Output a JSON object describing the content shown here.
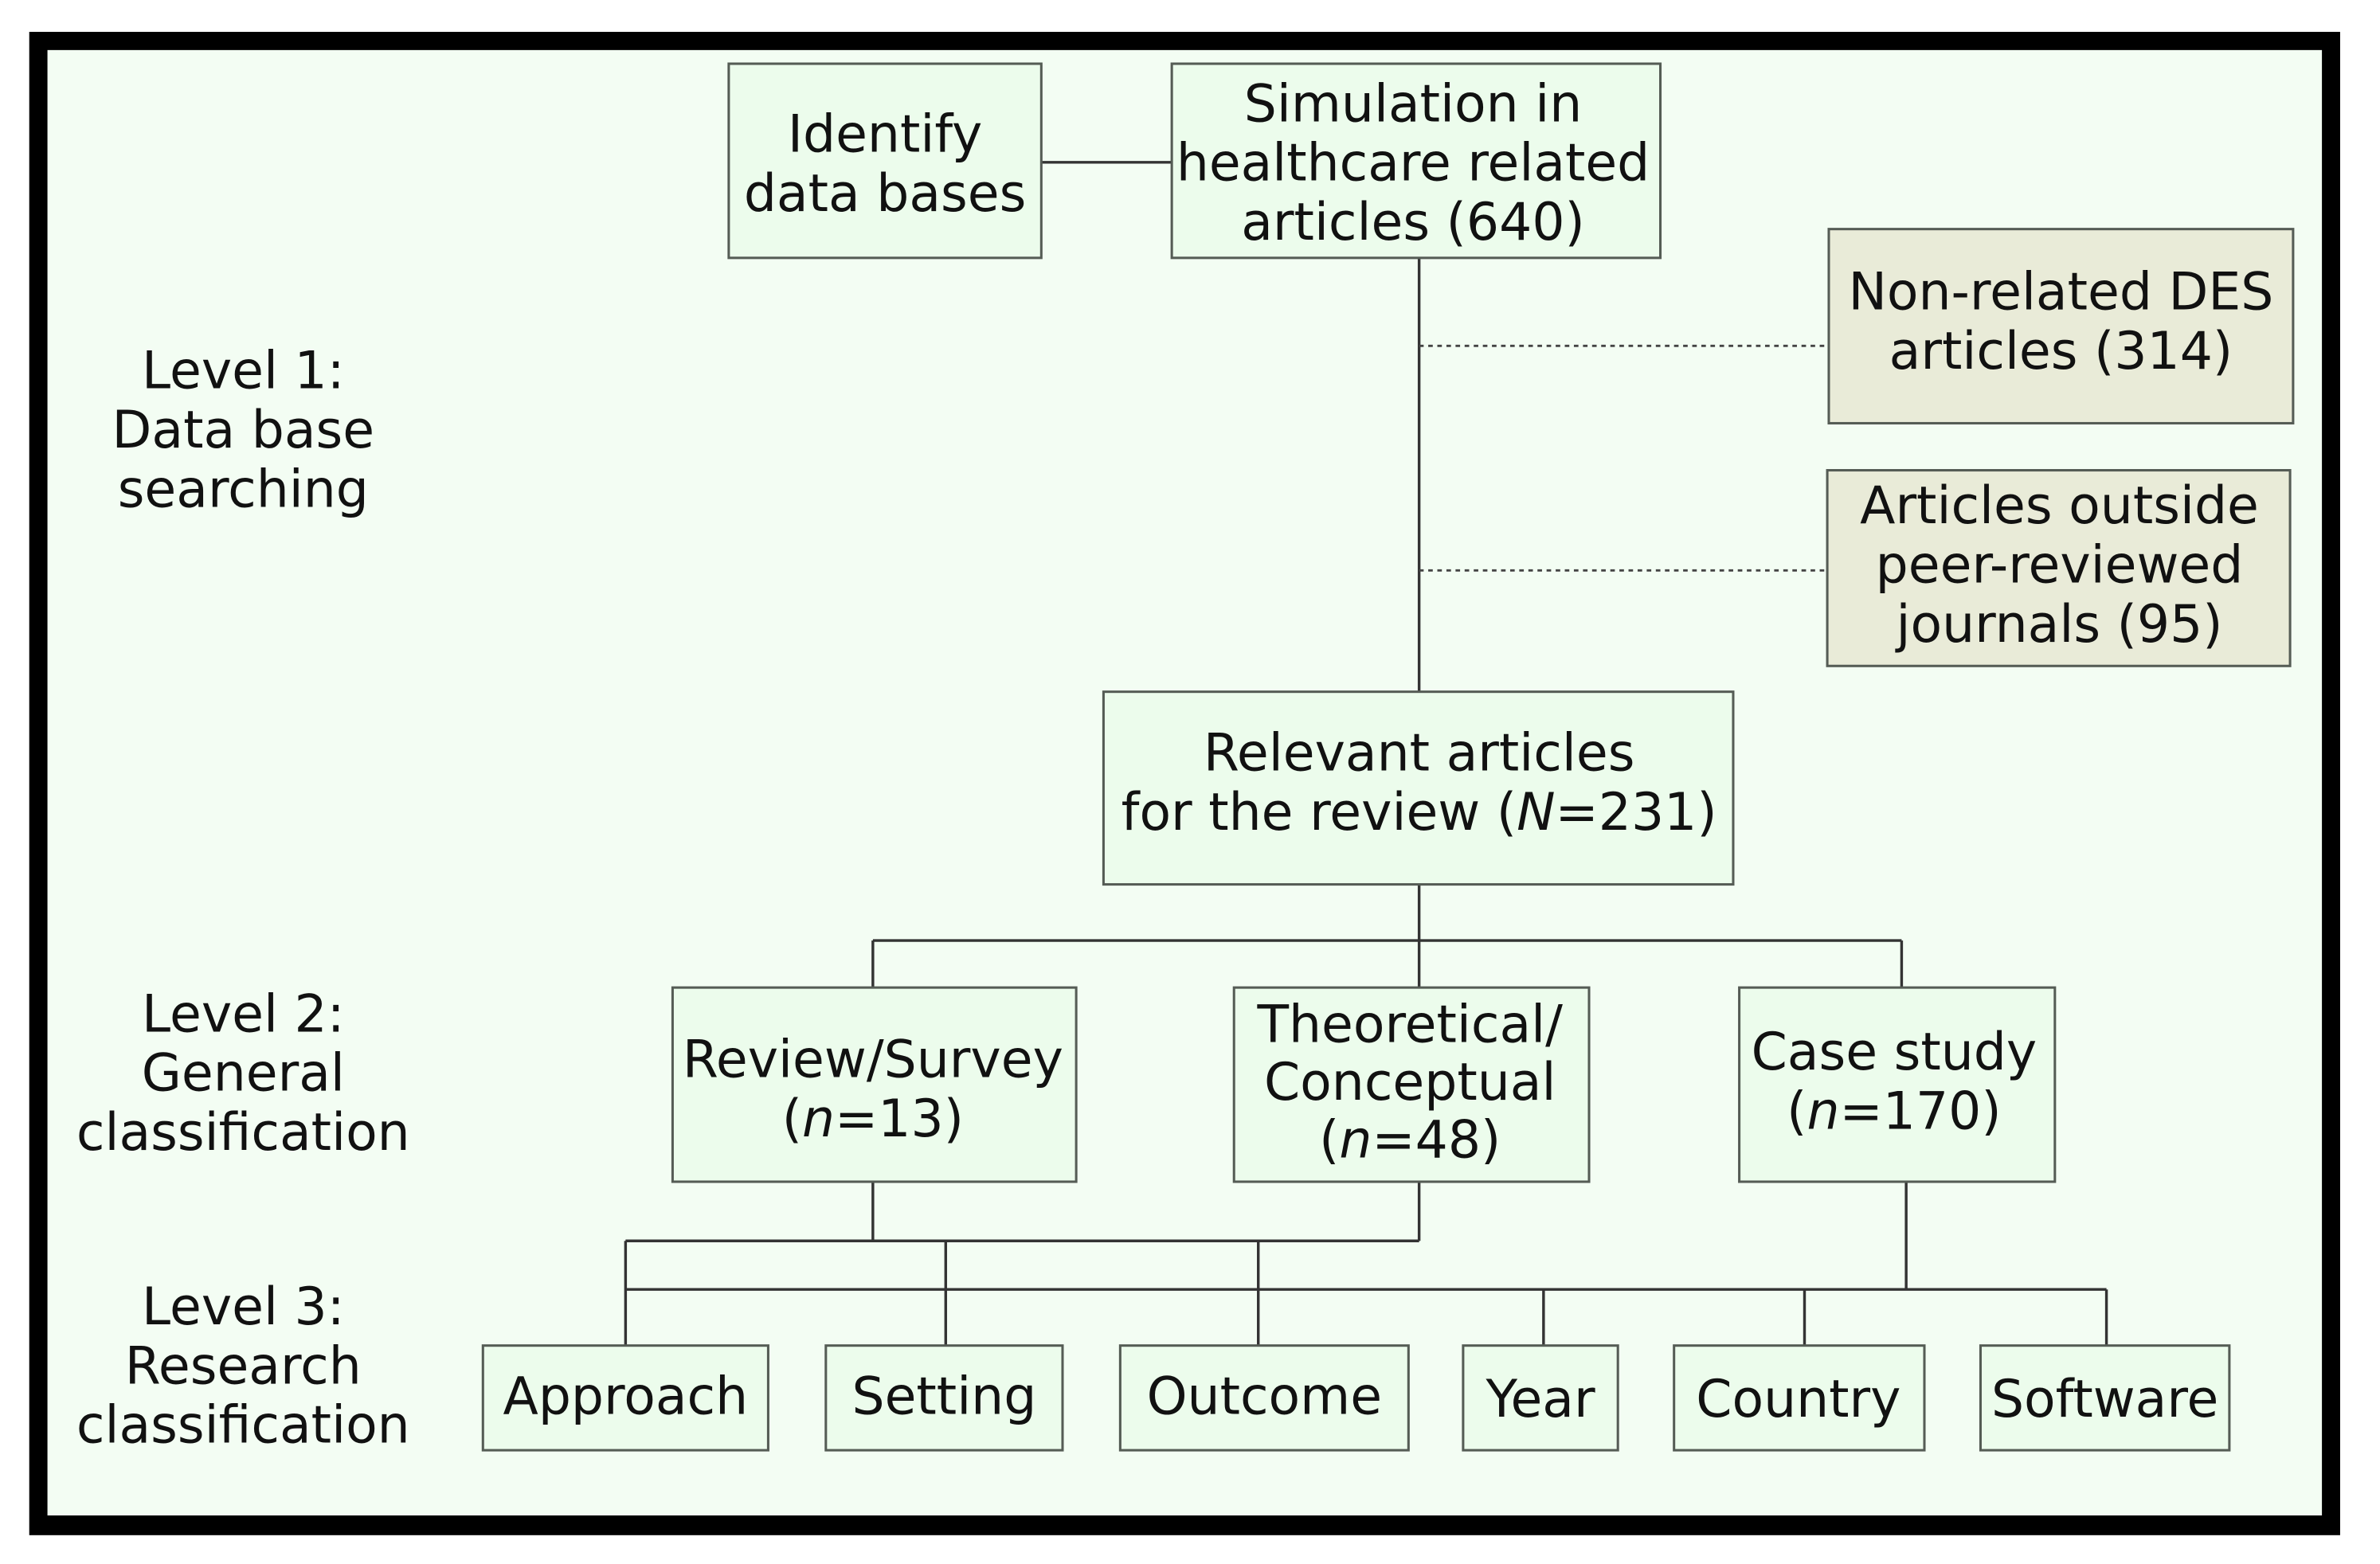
{
  "diagram": {
    "type": "flowchart",
    "colors": {
      "frame": "#000000",
      "background": "#f3fdf3",
      "node_fill": "#ecfcec",
      "excluded_fill": "#e9ebd8",
      "line": "#333333"
    },
    "levels": [
      {
        "id": "level1",
        "lines": [
          "Level 1:",
          "Data base",
          "searching"
        ]
      },
      {
        "id": "level2",
        "lines": [
          "Level 2:",
          "General",
          "classification"
        ]
      },
      {
        "id": "level3",
        "lines": [
          "Level 3:",
          "Research",
          "classification"
        ]
      }
    ],
    "nodes": {
      "identify": {
        "lines": [
          "Identify",
          "data bases"
        ]
      },
      "simulation": {
        "lines": [
          "Simulation in",
          "healthcare related",
          "articles (640)"
        ],
        "count": 640
      },
      "non_related": {
        "lines": [
          "Non-related DES",
          "articles (314)"
        ],
        "count": 314
      },
      "outside_peer": {
        "lines": [
          "Articles outside",
          "peer-reviewed",
          "journals (95)"
        ],
        "count": 95
      },
      "relevant": {
        "line1": "Relevant articles",
        "line2_pre": "for the review (",
        "var": "N",
        "line2_post": "=231)",
        "count": 231
      },
      "review": {
        "line1": "Review/Survey",
        "pre": "(",
        "var": "n",
        "post": "=13)",
        "count": 13
      },
      "theoretical": {
        "line1": "Theoretical/",
        "line2": "Conceptual",
        "pre": "(",
        "var": "n",
        "post": "=48)",
        "count": 48
      },
      "case": {
        "line1": "Case study",
        "pre": "(",
        "var": "n",
        "post": "=170)",
        "count": 170
      }
    },
    "research_categories": [
      {
        "label": "Approach"
      },
      {
        "label": "Setting"
      },
      {
        "label": "Outcome"
      },
      {
        "label": "Year"
      },
      {
        "label": "Country"
      },
      {
        "label": "Software"
      }
    ],
    "edges": [
      {
        "from": "identify",
        "to": "simulation",
        "style": "solid"
      },
      {
        "from": "simulation",
        "to": "non_related",
        "style": "dashed"
      },
      {
        "from": "simulation",
        "to": "outside_peer",
        "style": "dashed"
      },
      {
        "from": "simulation",
        "to": "relevant",
        "style": "solid"
      },
      {
        "from": "relevant",
        "to": "review",
        "style": "solid"
      },
      {
        "from": "relevant",
        "to": "theoretical",
        "style": "solid"
      },
      {
        "from": "relevant",
        "to": "case",
        "style": "solid"
      },
      {
        "from": "review",
        "to": "Approach",
        "style": "solid"
      },
      {
        "from": "review",
        "to": "Setting",
        "style": "solid"
      },
      {
        "from": "review",
        "to": "Outcome",
        "style": "solid"
      },
      {
        "from": "theoretical",
        "to": "Approach",
        "style": "solid"
      },
      {
        "from": "theoretical",
        "to": "Setting",
        "style": "solid"
      },
      {
        "from": "theoretical",
        "to": "Outcome",
        "style": "solid"
      },
      {
        "from": "case",
        "to": "Approach",
        "style": "solid"
      },
      {
        "from": "case",
        "to": "Setting",
        "style": "solid"
      },
      {
        "from": "case",
        "to": "Outcome",
        "style": "solid"
      },
      {
        "from": "case",
        "to": "Year",
        "style": "solid"
      },
      {
        "from": "case",
        "to": "Country",
        "style": "solid"
      },
      {
        "from": "case",
        "to": "Software",
        "style": "solid"
      }
    ]
  }
}
